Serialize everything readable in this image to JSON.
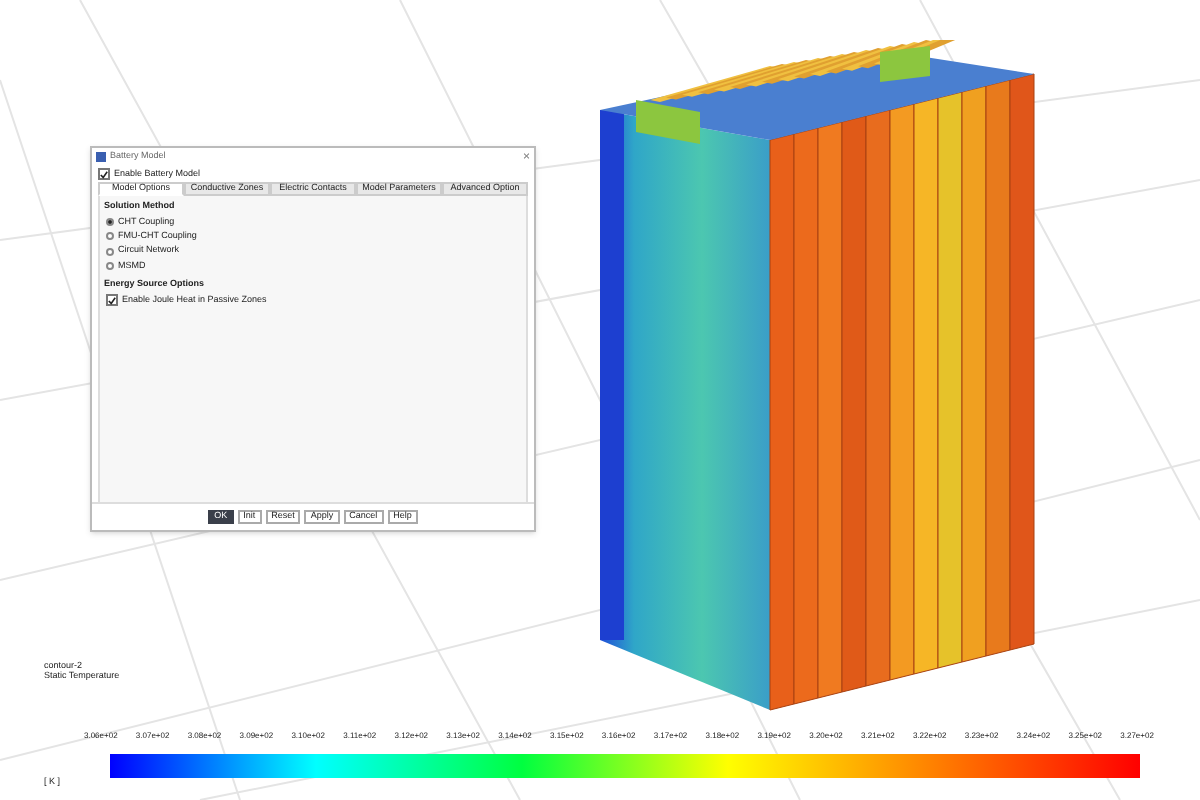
{
  "dialog": {
    "title": "Battery Model",
    "close": "×",
    "enable_battery_model": {
      "label": "Enable Battery Model",
      "checked": true
    },
    "tabs": [
      {
        "label": "Model Options",
        "selected": true
      },
      {
        "label": "Conductive Zones",
        "selected": false
      },
      {
        "label": "Electric Contacts",
        "selected": false
      },
      {
        "label": "Model Parameters",
        "selected": false
      },
      {
        "label": "Advanced Option",
        "selected": false
      }
    ],
    "solution_method": {
      "title": "Solution Method",
      "options": [
        {
          "label": "CHT Coupling",
          "selected": true
        },
        {
          "label": "FMU-CHT Coupling",
          "selected": false
        },
        {
          "label": "Circuit Network",
          "selected": false
        },
        {
          "label": "MSMD",
          "selected": false
        }
      ]
    },
    "energy_source_options": {
      "title": "Energy Source Options",
      "items": [
        {
          "label": "Enable Joule Heat in Passive Zones",
          "checked": true
        }
      ]
    },
    "buttons": [
      {
        "label": "OK",
        "selected": true
      },
      {
        "label": "Init",
        "selected": false
      },
      {
        "label": "Reset",
        "selected": false
      },
      {
        "label": "Apply",
        "selected": false
      },
      {
        "label": "Cancel",
        "selected": false
      },
      {
        "label": "Help",
        "selected": false
      }
    ]
  },
  "contour": {
    "name": "contour-2",
    "quantity": "Static Temperature",
    "unit": "[ K ]",
    "tick_labels": [
      "3.06e+02",
      "3.07e+02",
      "3.08e+02",
      "3.09e+02",
      "3.10e+02",
      "3.11e+02",
      "3.12e+02",
      "3.13e+02",
      "3.14e+02",
      "3.15e+02",
      "3.16e+02",
      "3.17e+02",
      "3.18e+02",
      "3.19e+02",
      "3.20e+02",
      "3.21e+02",
      "3.22e+02",
      "3.23e+02",
      "3.24e+02",
      "3.25e+02",
      "3.27e+02"
    ]
  }
}
